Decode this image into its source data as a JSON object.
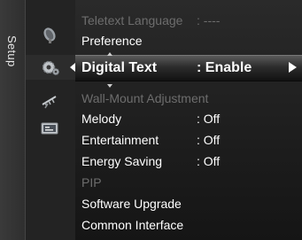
{
  "tab": {
    "label": "Setup"
  },
  "menu": {
    "items": [
      {
        "label": "Teletext Language",
        "value": ": ----",
        "state": "disabled"
      },
      {
        "label": "Preference",
        "value": "",
        "state": "normal"
      },
      {
        "label": "Digital Text",
        "value": ": Enable",
        "state": "selected"
      },
      {
        "label": "Wall-Mount Adjustment",
        "value": "",
        "state": "disabled"
      },
      {
        "label": "Melody",
        "value": ": Off",
        "state": "normal"
      },
      {
        "label": "Entertainment",
        "value": ": Off",
        "state": "normal"
      },
      {
        "label": "Energy Saving",
        "value": ": Off",
        "state": "normal"
      },
      {
        "label": "PIP",
        "value": "",
        "state": "disabled"
      },
      {
        "label": "Software Upgrade",
        "value": "",
        "state": "normal"
      },
      {
        "label": "Common Interface",
        "value": "",
        "state": "normal"
      }
    ]
  },
  "icons": [
    "satellite-dish-icon",
    "gear-settings-icon",
    "antenna-icon",
    "input-source-icon"
  ],
  "colors": {
    "text": "#ffffff",
    "disabled": "#6d6d6d",
    "background": "#1e1e1e"
  }
}
